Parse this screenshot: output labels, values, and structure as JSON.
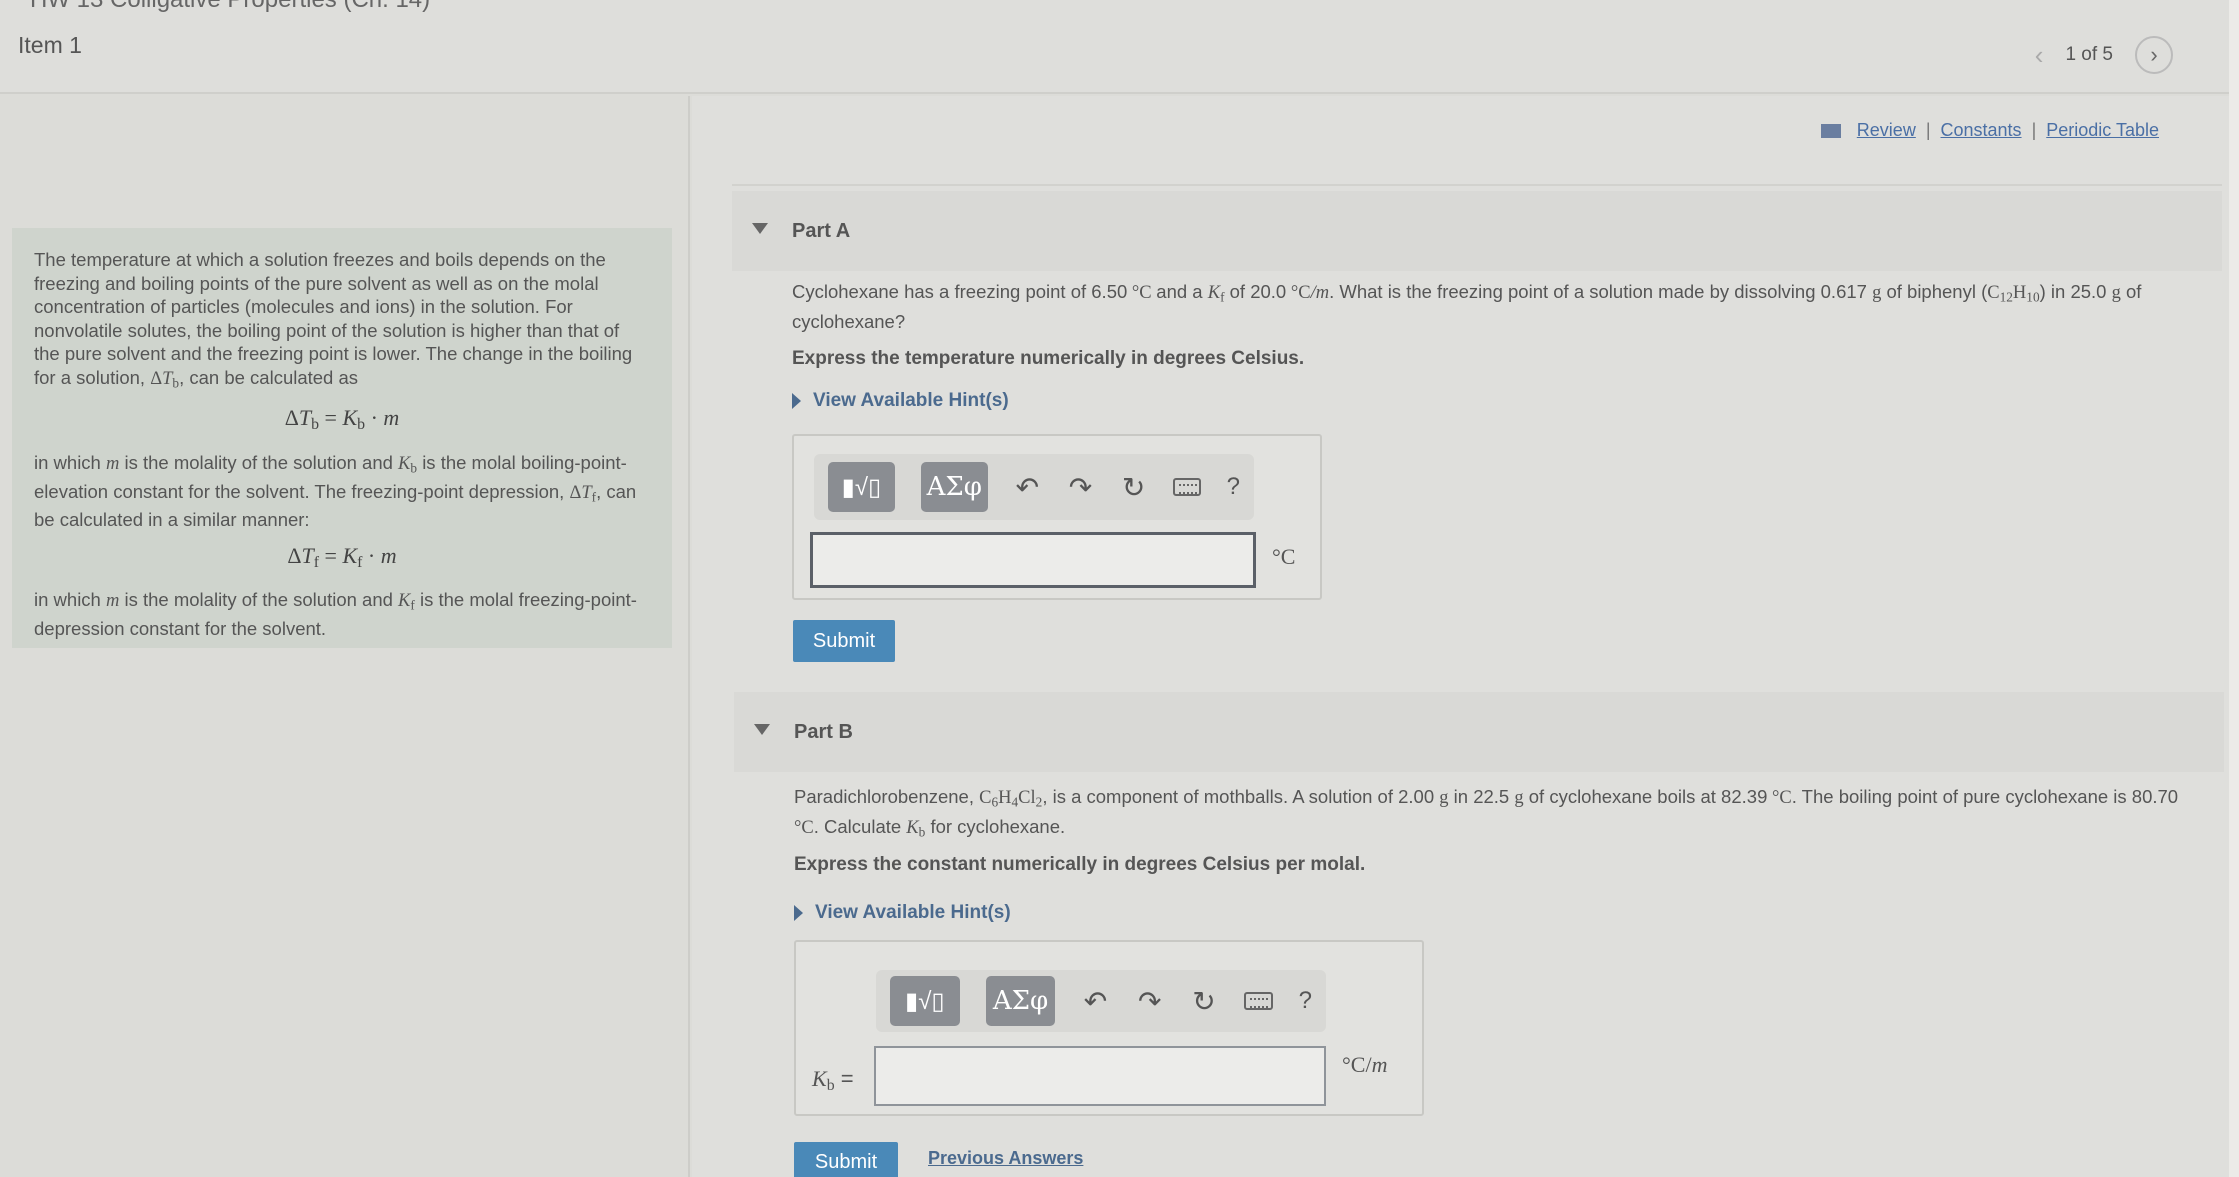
{
  "header": {
    "course_cut": "HW 13 Colligative Properties (Ch. 14)",
    "item_title": "Item 1",
    "pager_text": "1 of 5"
  },
  "links": {
    "review": "Review",
    "constants": "Constants",
    "periodic_table": "Periodic Table",
    "separator": "|"
  },
  "intro": {
    "p1": "The temperature at which a solution freezes and boils depends on the freezing and boiling points of the pure solvent as well as on the molal concentration of particles (molecules and ions) in the solution. For nonvolatile solutes, the boiling point of the solution is higher than that of the pure solvent and the freezing point is lower. The change in the boiling for a solution,",
    "p1_tail": ", can be calculated as",
    "p2_a": "in which",
    "p2_b": "is the molality of the solution and",
    "p2_c": "is the molal boiling-point-elevation constant for the solvent. The freezing-point depression,",
    "p2_d": ", can be calculated in a similar manner:",
    "p3_a": "in which",
    "p3_b": "is the molality of the solution and",
    "p3_c": "is the molal freezing-point-depression constant for the solvent."
  },
  "partA": {
    "title": "Part A",
    "q_1": "Cyclohexane has a freezing point of 6.50",
    "q_2": "and a",
    "q_3": "of 20.0",
    "q_4": ". What is the freezing point of a solution made by dissolving 0.617",
    "q_5": "of biphenyl (",
    "q_6": ") in 25.0",
    "q_7": "of cyclohexane?",
    "instruction": "Express the temperature numerically in degrees Celsius.",
    "hint": "View Available Hint(s)",
    "unit": "°C",
    "submit": "Submit",
    "input_value": ""
  },
  "partB": {
    "title": "Part B",
    "q_1": "Paradichlorobenzene,",
    "q_2": ", is a component of mothballs. A solution of 2.00",
    "q_3": "in 22.5",
    "q_4": "of cyclohexane boils at 82.39",
    "q_5": ". The boiling point of pure cyclohexane is 80.70",
    "q_6": ". Calculate",
    "q_7": "for cyclohexane.",
    "instruction": "Express the constant numerically in degrees Celsius per molal.",
    "hint": "View Available Hint(s)",
    "label_eq": "=",
    "unit": "°C/m",
    "submit": "Submit",
    "previous_answers": "Previous Answers",
    "input_value": ""
  },
  "toolbar": {
    "templates": "▮√▯",
    "greek": "ΑΣφ",
    "undo": "↶",
    "redo": "↷",
    "reset": "↻",
    "help": "?"
  }
}
